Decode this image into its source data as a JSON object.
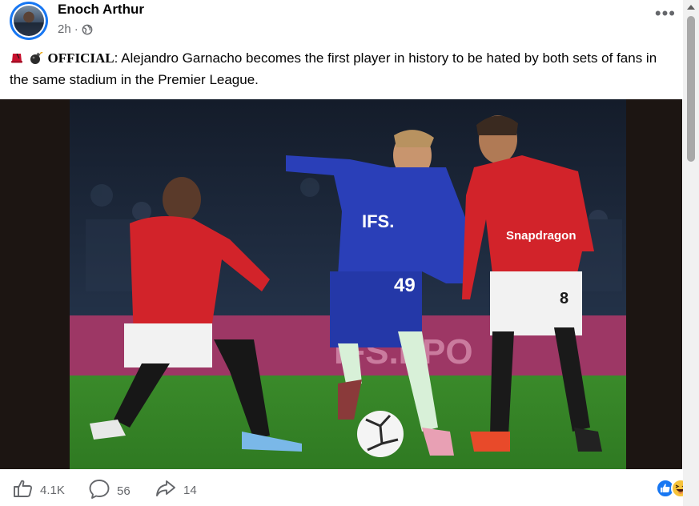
{
  "post": {
    "author": "Enoch Arthur",
    "time": "2h",
    "separator": "·",
    "privacy_icon": "globe-icon",
    "more_icon": "more-options-icon",
    "more_text": "•••",
    "caption": {
      "emojis": [
        "fez-hat-emoji",
        "bomb-emoji"
      ],
      "tag": "OFFICIAL",
      "colon": ":",
      "text": " Alejandro Garnacho becomes the first player in history to be hated by both sets of fans in the same stadium in the Premier League."
    },
    "photo": {
      "description": "football-match-photo",
      "jersey_numbers": [
        "49",
        "8"
      ],
      "sponsor_text": "Snapdragon",
      "sponsor_text_2": "IFS.",
      "board_text": "IFS.EPO"
    }
  },
  "footer": {
    "likes_count": "4.1K",
    "comments_count": "56",
    "shares_count": "14",
    "like_icon": "thumbs-up-icon",
    "comment_icon": "comment-bubble-icon",
    "share_icon": "share-arrow-icon",
    "reaction_icons": [
      "like-reaction-icon",
      "haha-reaction-icon"
    ]
  },
  "colors": {
    "accent": "#1877f2",
    "meta_gray": "#65676b",
    "man_utd_red": "#d2232a",
    "chelsea_blue": "#2a3fb8",
    "pitch_green": "#3f8a2c"
  }
}
